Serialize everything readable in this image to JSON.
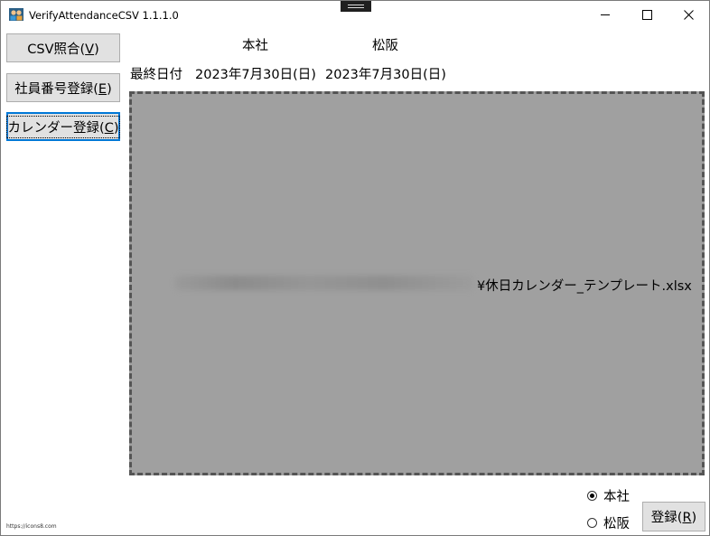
{
  "window": {
    "title": "VerifyAttendanceCSV 1.1.1.0"
  },
  "sidebar": {
    "buttons": [
      {
        "label": "CSV照合(",
        "key": "V",
        "suffix": ")"
      },
      {
        "label": "社員番号登録(",
        "key": "E",
        "suffix": ")"
      },
      {
        "label": "カレンダー登録(",
        "key": "C",
        "suffix": ")"
      }
    ]
  },
  "header": {
    "col1": "本社",
    "col2": "松阪",
    "last_date_label": "最終日付",
    "date1": "2023年7月30日(日)",
    "date2": "2023年7月30日(日)"
  },
  "drop_area": {
    "file_path_tail": "¥休日カレンダー_テンプレート.xlsx"
  },
  "radios": [
    {
      "label": "本社",
      "selected": true
    },
    {
      "label": "松阪",
      "selected": false
    }
  ],
  "register_button": {
    "label": "登録(",
    "key": "R",
    "suffix": ")"
  },
  "credit": "https://icons8.com"
}
